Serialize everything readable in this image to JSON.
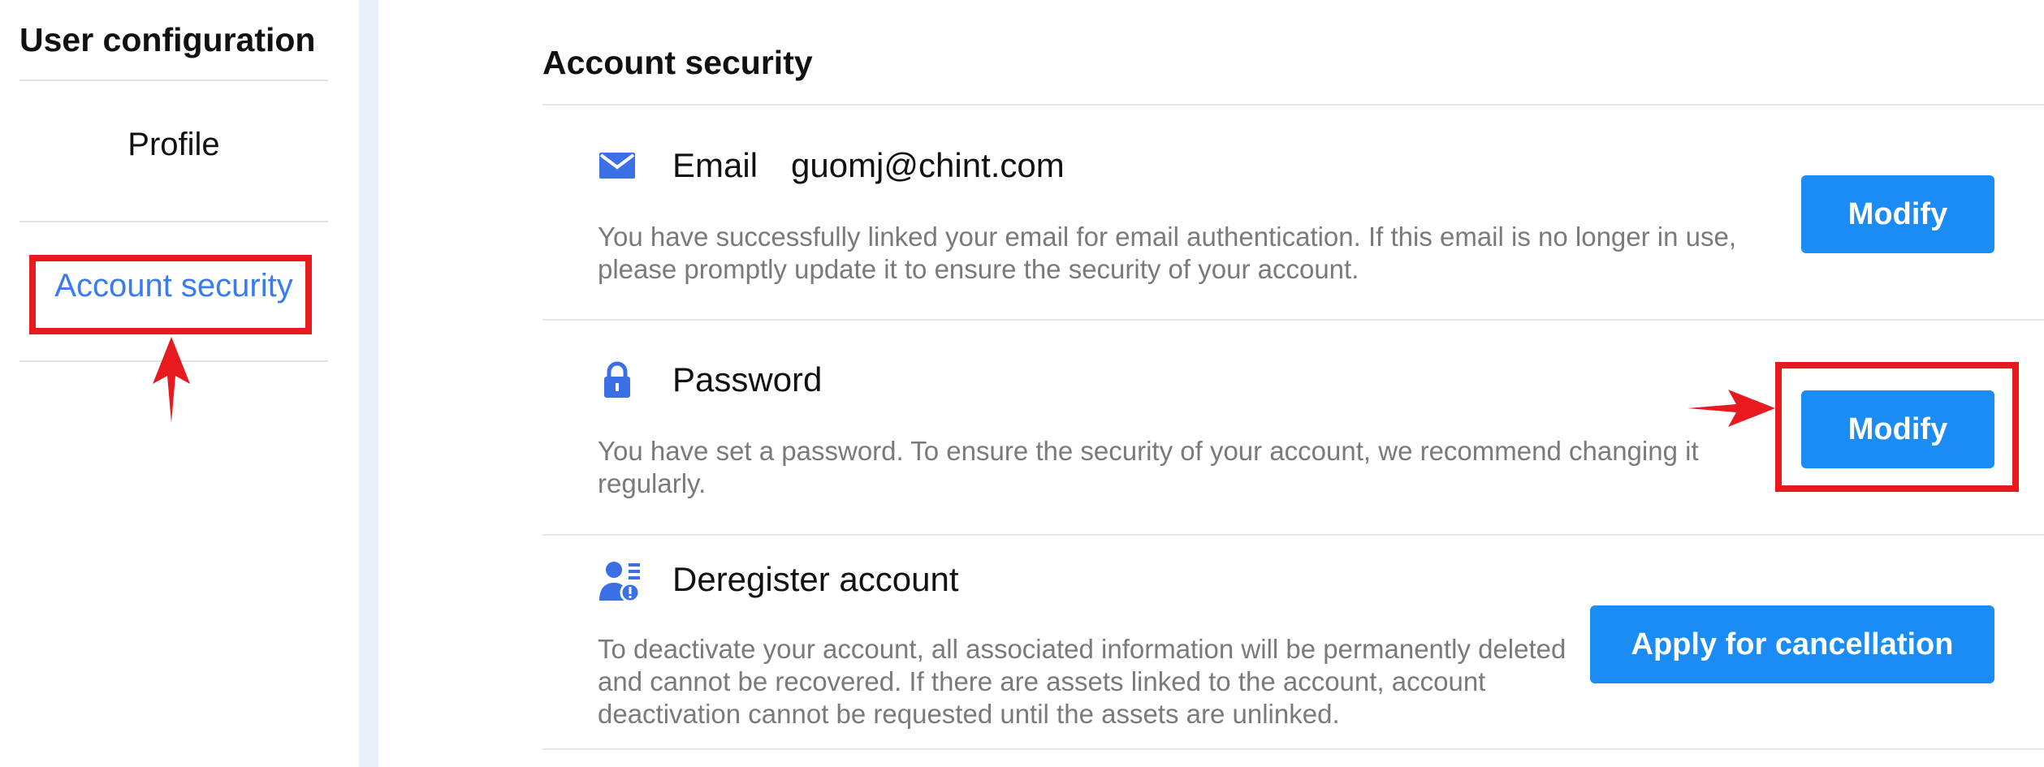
{
  "sidebar": {
    "title": "User configuration",
    "items": [
      {
        "label": "Profile"
      },
      {
        "label": "Account security"
      }
    ]
  },
  "main": {
    "title": "Account security",
    "rows": [
      {
        "icon": "envelope-icon",
        "label": "Email",
        "value": "guomj@chint.com",
        "description": "You have successfully linked your email for email authentication. If this email is no longer in use, please promptly update it to ensure the security of your account.",
        "button_label": "Modify"
      },
      {
        "icon": "lock-icon",
        "label": "Password",
        "value": "",
        "description": "You have set a password. To ensure the security of your account, we recommend changing it regularly.",
        "button_label": "Modify"
      },
      {
        "icon": "user-deregister-icon",
        "label": "Deregister account",
        "value": "",
        "description": "To deactivate your account, all associated information will be permanently deleted and cannot be recovered. If there are assets linked to the account, account deactivation cannot be requested until the assets are unlinked.",
        "button_label": "Apply for cancellation"
      }
    ]
  },
  "colors": {
    "accent": "#1a8cf3",
    "active_link": "#3a7bef",
    "annotation": "#e8191f",
    "icon": "#3a6fe6",
    "separator": "#e8f0fa"
  }
}
